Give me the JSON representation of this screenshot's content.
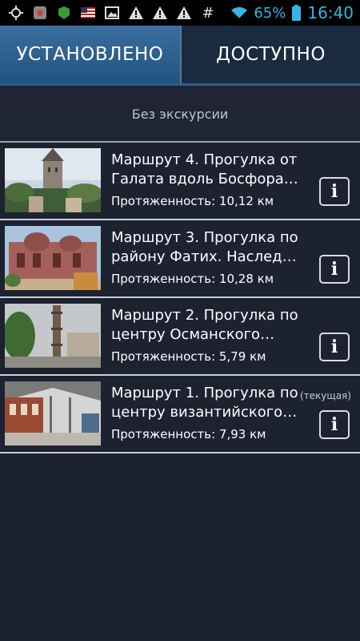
{
  "status_bar": {
    "icons": [
      "gps-icon",
      "app-icon",
      "security-icon",
      "flag-icon",
      "image-icon",
      "warning-icon",
      "warning-icon",
      "warning-icon",
      "hash-icon"
    ],
    "battery_percent": "65%",
    "time": "16:40",
    "accent_color": "#33b5e5"
  },
  "tabs": {
    "installed": "УСТАНОВЛЕНО",
    "available": "ДОСТУПНО",
    "active": "installed"
  },
  "no_tour_label": "Без экскурсии",
  "routes": [
    {
      "title_line1": "Маршрут 4. Прогулка от",
      "title_line2": "Галата вдоль Босфора…",
      "length": "Протяженность: 10,12 км",
      "current": ""
    },
    {
      "title_line1": "Маршрут 3. Прогулка по",
      "title_line2": "району Фатих. Наслед…",
      "length": "Протяженность: 10,28 км",
      "current": ""
    },
    {
      "title_line1": "Маршрут 2. Прогулка по",
      "title_line2": "центру Османского…",
      "length": "Протяженность: 5,79 км",
      "current": ""
    },
    {
      "title_line1": "Маршрут 1. Прогулка по",
      "title_line2": "центру византийского…",
      "length": "Протяженность: 7,93 км",
      "current": "(текущая)"
    }
  ],
  "info_glyph": "i"
}
